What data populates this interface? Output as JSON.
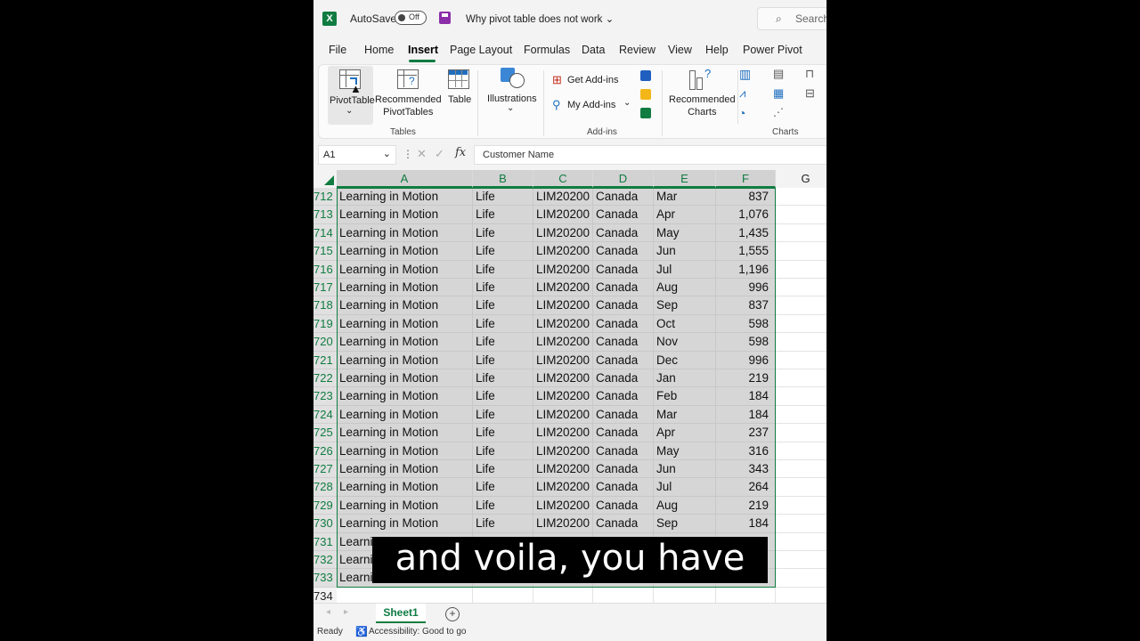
{
  "titlebar": {
    "autosave_label": "AutoSave",
    "autosave_state": "Off",
    "doc_title": "Why pivot table does not work",
    "search_placeholder": "Search"
  },
  "menu": [
    "File",
    "Home",
    "Insert",
    "Page Layout",
    "Formulas",
    "Data",
    "Review",
    "View",
    "Help",
    "Power Pivot"
  ],
  "active_menu": "Insert",
  "ribbon": {
    "pivottable": "PivotTable",
    "recommended_pivottables_1": "Recommended",
    "recommended_pivottables_2": "PivotTables",
    "table": "Table",
    "tables_group": "Tables",
    "illustrations": "Illustrations",
    "get_addins": "Get Add-ins",
    "my_addins": "My Add-ins",
    "addins_group": "Add-ins",
    "recommended_charts_1": "Recommended",
    "recommended_charts_2": "Charts",
    "charts_group": "Charts"
  },
  "formula_bar": {
    "name_box": "A1",
    "fx": "fx",
    "content": "Customer Name"
  },
  "columns": [
    "A",
    "B",
    "C",
    "D",
    "E",
    "F",
    "G"
  ],
  "rows": [
    {
      "n": "712",
      "a": "Learning in Motion",
      "b": "Life",
      "c": "LIM20200",
      "d": "Canada",
      "e": "Mar",
      "f": "837"
    },
    {
      "n": "713",
      "a": "Learning in Motion",
      "b": "Life",
      "c": "LIM20200",
      "d": "Canada",
      "e": "Apr",
      "f": "1,076"
    },
    {
      "n": "714",
      "a": "Learning in Motion",
      "b": "Life",
      "c": "LIM20200",
      "d": "Canada",
      "e": "May",
      "f": "1,435"
    },
    {
      "n": "715",
      "a": "Learning in Motion",
      "b": "Life",
      "c": "LIM20200",
      "d": "Canada",
      "e": "Jun",
      "f": "1,555"
    },
    {
      "n": "716",
      "a": "Learning in Motion",
      "b": "Life",
      "c": "LIM20200",
      "d": "Canada",
      "e": "Jul",
      "f": "1,196"
    },
    {
      "n": "717",
      "a": "Learning in Motion",
      "b": "Life",
      "c": "LIM20200",
      "d": "Canada",
      "e": "Aug",
      "f": "996"
    },
    {
      "n": "718",
      "a": "Learning in Motion",
      "b": "Life",
      "c": "LIM20200",
      "d": "Canada",
      "e": "Sep",
      "f": "837"
    },
    {
      "n": "719",
      "a": "Learning in Motion",
      "b": "Life",
      "c": "LIM20200",
      "d": "Canada",
      "e": "Oct",
      "f": "598"
    },
    {
      "n": "720",
      "a": "Learning in Motion",
      "b": "Life",
      "c": "LIM20200",
      "d": "Canada",
      "e": "Nov",
      "f": "598"
    },
    {
      "n": "721",
      "a": "Learning in Motion",
      "b": "Life",
      "c": "LIM20200",
      "d": "Canada",
      "e": "Dec",
      "f": "996"
    },
    {
      "n": "722",
      "a": "Learning in Motion",
      "b": "Life",
      "c": "LIM20200",
      "d": "Canada",
      "e": "Jan",
      "f": "219"
    },
    {
      "n": "723",
      "a": "Learning in Motion",
      "b": "Life",
      "c": "LIM20200",
      "d": "Canada",
      "e": "Feb",
      "f": "184"
    },
    {
      "n": "724",
      "a": "Learning in Motion",
      "b": "Life",
      "c": "LIM20200",
      "d": "Canada",
      "e": "Mar",
      "f": "184"
    },
    {
      "n": "725",
      "a": "Learning in Motion",
      "b": "Life",
      "c": "LIM20200",
      "d": "Canada",
      "e": "Apr",
      "f": "237"
    },
    {
      "n": "726",
      "a": "Learning in Motion",
      "b": "Life",
      "c": "LIM20200",
      "d": "Canada",
      "e": "May",
      "f": "316"
    },
    {
      "n": "727",
      "a": "Learning in Motion",
      "b": "Life",
      "c": "LIM20200",
      "d": "Canada",
      "e": "Jun",
      "f": "343"
    },
    {
      "n": "728",
      "a": "Learning in Motion",
      "b": "Life",
      "c": "LIM20200",
      "d": "Canada",
      "e": "Jul",
      "f": "264"
    },
    {
      "n": "729",
      "a": "Learning in Motion",
      "b": "Life",
      "c": "LIM20200",
      "d": "Canada",
      "e": "Aug",
      "f": "219"
    },
    {
      "n": "730",
      "a": "Learning in Motion",
      "b": "Life",
      "c": "LIM20200",
      "d": "Canada",
      "e": "Sep",
      "f": "184"
    },
    {
      "n": "731",
      "a": "Learni",
      "b": "",
      "c": "",
      "d": "",
      "e": "",
      "f": ""
    },
    {
      "n": "732",
      "a": "Learni",
      "b": "",
      "c": "",
      "d": "",
      "e": "",
      "f": ""
    },
    {
      "n": "733",
      "a": "Learni",
      "b": "",
      "c": "",
      "d": "",
      "e": "",
      "f": ""
    },
    {
      "n": "734",
      "a": "",
      "b": "",
      "c": "",
      "d": "",
      "e": "",
      "f": "",
      "empty": true
    }
  ],
  "sheet_tab": "Sheet1",
  "status": {
    "ready": "Ready",
    "accessibility": "Accessibility: Good to go"
  },
  "caption": "and voila, you have",
  "colors": {
    "excel_green": "#107c41",
    "selection_fill": "#d6d6d6"
  }
}
